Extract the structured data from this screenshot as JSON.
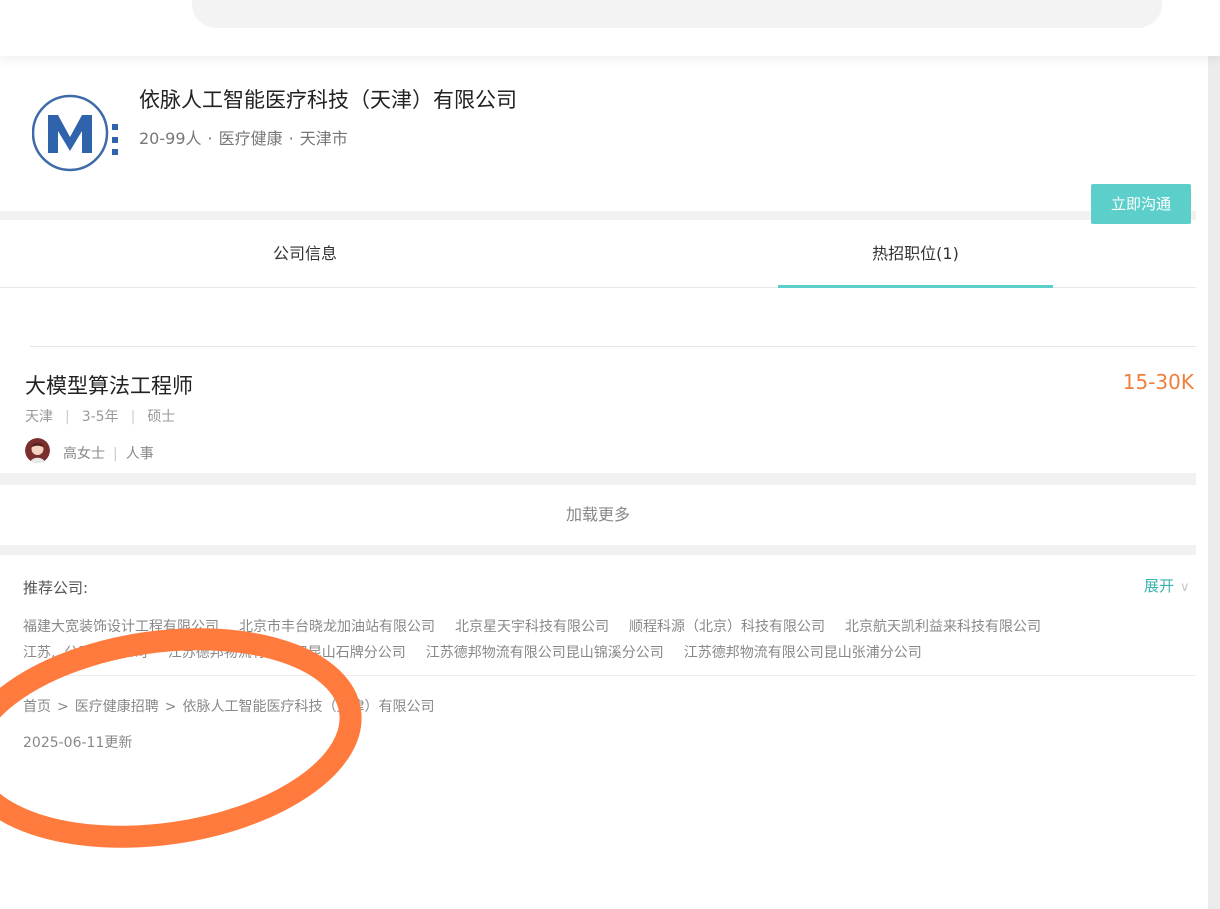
{
  "company": {
    "name": "依脉人工智能医疗科技（天津）有限公司",
    "size": "20-99人",
    "industry": "医疗健康",
    "city": "天津市",
    "separator": "·"
  },
  "tabs": [
    {
      "label": "公司信息",
      "active": false
    },
    {
      "label": "热招职位(1)",
      "active": true
    }
  ],
  "job": {
    "title": "大模型算法工程师",
    "salary": "15-30K",
    "location": "天津",
    "experience": "3-5年",
    "education": "硕士",
    "recruiter_name": "高女士",
    "recruiter_role": "人事",
    "chat_button": "立即沟通"
  },
  "load_more": "加载更多",
  "recommend": {
    "label": "推荐公司:",
    "expand": "展开",
    "row1": [
      "福建大宽装饰设计工程有限公司",
      "北京市丰台晓龙加油站有限公司",
      "北京星天宇科技有限公司",
      "顺程科源（北京）科技有限公司",
      "北京航天凯利益来科技有限公司"
    ],
    "row2": [
      "江苏...公司昆山...司",
      "江苏德邦物流有限公司昆山石牌分公司",
      "江苏德邦物流有限公司昆山锦溪分公司",
      "江苏德邦物流有限公司昆山张浦分公司"
    ]
  },
  "breadcrumb": {
    "home": "首页",
    "category": "医疗健康招聘",
    "current": "依脉人工智能医疗科技（天津）有限公司",
    "arrow": ">"
  },
  "updated": "2025-06-11更新",
  "colors": {
    "accent": "#5dcfca",
    "salary": "#f07f3c",
    "annotation": "#ff7a3d"
  }
}
